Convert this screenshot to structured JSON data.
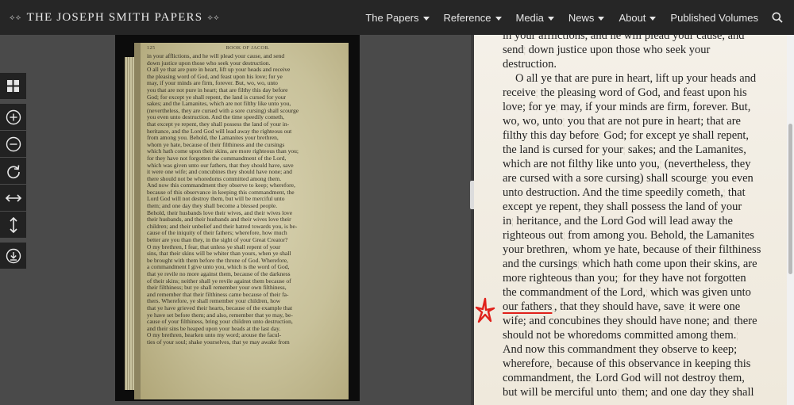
{
  "header": {
    "brand": "THE JOSEPH SMITH PAPERS",
    "nav": [
      {
        "label": "The Papers"
      },
      {
        "label": "Reference"
      },
      {
        "label": "Media"
      },
      {
        "label": "News"
      },
      {
        "label": "About"
      }
    ],
    "published_volumes": "Published Volumes"
  },
  "toolbar": {
    "tools": [
      "grid-view-icon",
      "zoom-in-icon",
      "zoom-out-icon",
      "rotate-icon",
      "fit-width-icon",
      "fit-height-icon",
      "download-icon"
    ]
  },
  "scan": {
    "page_number": "125",
    "running_head": "BOOK OF JACOB.",
    "lines": [
      "in your afflictions, and he will plead your cause, and send",
      "down justice upon those who seek your destruction.",
      "O all ye that are pure in heart, lift up your heads and receive",
      "the pleasing word of God, and feast upon his love; for ye",
      "may, if your minds are firm, forever. But, wo, wo, unto",
      "you that are not pure in heart; that are filthy this day before",
      "God; for except ye shall repent, the land is cursed for your",
      "sakes; and the Lamanites, which are not filthy like unto you,",
      "(nevertheless, they are cursed with a sore cursing) shall scourge",
      "you even unto destruction. And the time speedily cometh,",
      "that except ye repent, they shall possess the land of your in-",
      "heritance, and the Lord God will lead away the righteous out",
      "from among you. Behold, the Lamanites your brethren,",
      "whom ye hate, because of their filthiness and the cursings",
      "which hath come upon their skins, are more righteous than you;",
      "for they have not forgotten the commandment of the Lord,",
      "which was given unto our fathers, that they should have, save",
      "it were one wife; and concubines they should have none; and",
      "there should not be whoredoms committed among them.",
      "And now this commandment they observe to keep; wherefore,",
      "because of this observance in keeping this commandment, the",
      "Lord God will not destroy them, but will be merciful unto",
      "them; and one day they shall become a blessed people.",
      "Behold, their husbands love their wives, and their wives love",
      "their husbands, and their husbands and their wives love their",
      "children; and their unbelief and their hatred towards you, is be-",
      "cause of the iniquity of their fathers; wherefore, how much",
      "better are you than they, in the sight of your Great Creator?",
      "O my brethren, I fear, that unless ye shall repent of your",
      "sins, that their skins will be whiter than yours, when ye shall",
      "be brought with them before the throne of God. Wherefore,",
      "a commandment I give unto you, which is the word of God,",
      "that ye revile no more against them, because of the darkness",
      "of their skins; neither shall ye revile against them because of",
      "their filthiness; but ye shall remember your own filthiness,",
      "and remember that their filthiness came because of their fa-",
      "thers. Wherefore, ye shall remember your children, how",
      "that ye have grieved their hearts, because of the example that",
      "ye have set before them; and also, remember that ye may, be-",
      "cause of your filthiness, bring your children unto destruction,",
      "and their sins be heaped upon your heads at the last day.",
      "O my brethren, hearken unto my word; arouse the facul-",
      "ties of your soul; shake yourselves, that ye may awake from"
    ]
  },
  "transcript": {
    "lines": [
      {
        "segments": [
          "in your afflictions, and he will plead your cause, and"
        ]
      },
      {
        "segments": [
          "send",
          " down justice upon those who seek your"
        ]
      },
      {
        "segments": [
          "destruction."
        ]
      },
      {
        "segments": [
          "O all ye that are pure in heart, lift up your heads and"
        ],
        "indent": true
      },
      {
        "segments": [
          "receive",
          " the pleasing word of God, and feast upon his"
        ]
      },
      {
        "segments": [
          "love; for ye",
          " may, if your minds are firm, forever. But,"
        ]
      },
      {
        "segments": [
          "wo, wo, unto",
          " you that are not pure in heart; that are"
        ]
      },
      {
        "segments": [
          "filthy this day before",
          " God; for except ye shall repent,"
        ]
      },
      {
        "segments": [
          "the land is cursed for your",
          " sakes; and the Lamanites,"
        ]
      },
      {
        "segments": [
          "which are not filthy like unto you,",
          " (nevertheless, they"
        ]
      },
      {
        "segments": [
          "are cursed with a sore cursing) shall scourge",
          " you even"
        ]
      },
      {
        "segments": [
          "unto destruction. And the time speedily cometh,",
          " that"
        ]
      },
      {
        "segments": [
          "except ye repent, they shall possess the land of your"
        ]
      },
      {
        "segments": [
          "in",
          " heritance, and the Lord God will lead away the"
        ]
      },
      {
        "segments": [
          "righteous out",
          " from among you. Behold, the Lamanites"
        ]
      },
      {
        "segments": [
          "your brethren,",
          " whom ye hate, because of their filthiness"
        ]
      },
      {
        "segments": [
          "and the cursings",
          " which hath come upon their skins, are"
        ]
      },
      {
        "segments": [
          "more righteous than you;",
          " for they have not forgotten"
        ]
      },
      {
        "segments": [
          "the commandment of the Lord,",
          " which was given unto"
        ]
      },
      {
        "segments": [
          "our fathers",
          ", that they should have, save",
          " it were one"
        ]
      },
      {
        "segments": [
          "wife; and concubines they should have none; and",
          " there"
        ]
      },
      {
        "segments": [
          "should not be whoredoms committed among them.",
          ""
        ]
      },
      {
        "segments": [
          "And now this commandment they observe to keep;"
        ]
      },
      {
        "segments": [
          "wherefore,",
          " because of this observance in keeping this"
        ]
      },
      {
        "segments": [
          "commandment, the",
          " Lord God will not destroy them,"
        ]
      },
      {
        "segments": [
          "but will be merciful unto",
          " them; and one day they shall"
        ]
      }
    ]
  },
  "colors": {
    "annotation": "#e0201a",
    "nav_bg": "#262626",
    "paper": "#f4f0e8"
  }
}
